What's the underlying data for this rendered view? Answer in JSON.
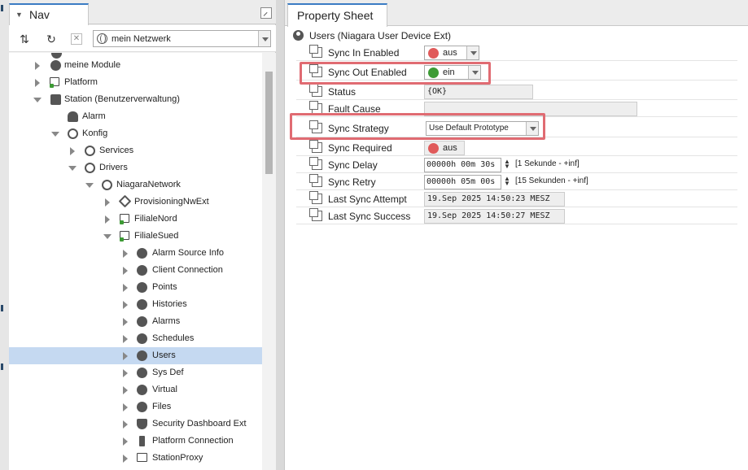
{
  "nav": {
    "tab_label": "Nav",
    "network_select": "mein Netzwerk",
    "tree": [
      {
        "label": "meine Module",
        "icon": "module-icon",
        "expanded": false
      },
      {
        "label": "Platform",
        "icon": "platform-icon",
        "expanded": false
      },
      {
        "label": "Station (Benutzerverwaltung)",
        "icon": "station-icon",
        "expanded": true
      },
      {
        "label": "Alarm",
        "icon": "bell-icon",
        "expanded": null
      },
      {
        "label": "Konfig",
        "icon": "database-icon",
        "expanded": true
      },
      {
        "label": "Services",
        "icon": "services-icon",
        "expanded": false
      },
      {
        "label": "Drivers",
        "icon": "drivers-icon",
        "expanded": true
      },
      {
        "label": "NiagaraNetwork",
        "icon": "network-icon",
        "expanded": true
      },
      {
        "label": "ProvisioningNwExt",
        "icon": "provisioning-icon",
        "expanded": false
      },
      {
        "label": "FilialeNord",
        "icon": "station-device-icon",
        "expanded": false
      },
      {
        "label": "FilialeSued",
        "icon": "station-device-icon",
        "expanded": true
      },
      {
        "label": "Alarm Source Info",
        "icon": "alarm-source-icon",
        "expanded": false
      },
      {
        "label": "Client Connection",
        "icon": "client-connection-icon",
        "expanded": false
      },
      {
        "label": "Points",
        "icon": "points-icon",
        "expanded": false
      },
      {
        "label": "Histories",
        "icon": "histories-icon",
        "expanded": false
      },
      {
        "label": "Alarms",
        "icon": "alarms-icon",
        "expanded": false
      },
      {
        "label": "Schedules",
        "icon": "schedules-icon",
        "expanded": false
      },
      {
        "label": "Users",
        "icon": "users-icon",
        "expanded": false,
        "selected": true
      },
      {
        "label": "Sys Def",
        "icon": "sysdef-icon",
        "expanded": false
      },
      {
        "label": "Virtual",
        "icon": "virtual-icon",
        "expanded": false
      },
      {
        "label": "Files",
        "icon": "files-icon",
        "expanded": false
      },
      {
        "label": "Security Dashboard Ext",
        "icon": "shield-icon",
        "expanded": false
      },
      {
        "label": "Platform Connection",
        "icon": "plug-icon",
        "expanded": false
      },
      {
        "label": "StationProxy",
        "icon": "monitor-icon",
        "expanded": false
      }
    ]
  },
  "sheet": {
    "tab_label": "Property Sheet",
    "header": "Users  (Niagara User Device Ext)",
    "props": {
      "sync_in_enabled": {
        "name": "Sync In Enabled",
        "value": "aus"
      },
      "sync_out_enabled": {
        "name": "Sync Out Enabled",
        "value": "ein"
      },
      "status": {
        "name": "Status",
        "value": "{OK}"
      },
      "fault_cause": {
        "name": "Fault Cause",
        "value": ""
      },
      "sync_strategy": {
        "name": "Sync Strategy",
        "value": "Use Default Prototype"
      },
      "sync_required": {
        "name": "Sync Required",
        "value": "aus"
      },
      "sync_delay": {
        "name": "Sync Delay",
        "value": "00000h 00m 30s",
        "range": "[1 Sekunde - +inf]"
      },
      "sync_retry": {
        "name": "Sync Retry",
        "value": "00000h 05m 00s",
        "range": "[15 Sekunden - +inf]"
      },
      "last_sync_attempt": {
        "name": "Last Sync Attempt",
        "value": "19.Sep 2025 14:50:23 MESZ"
      },
      "last_sync_success": {
        "name": "Last Sync Success",
        "value": "19.Sep 2025 14:50:27 MESZ"
      }
    }
  },
  "colors": {
    "accent": "#3b7cc4",
    "selection": "#c5d9f1",
    "false_dot": "#e05a5a",
    "true_dot": "#3d9b35",
    "highlight": "#e06b72"
  }
}
